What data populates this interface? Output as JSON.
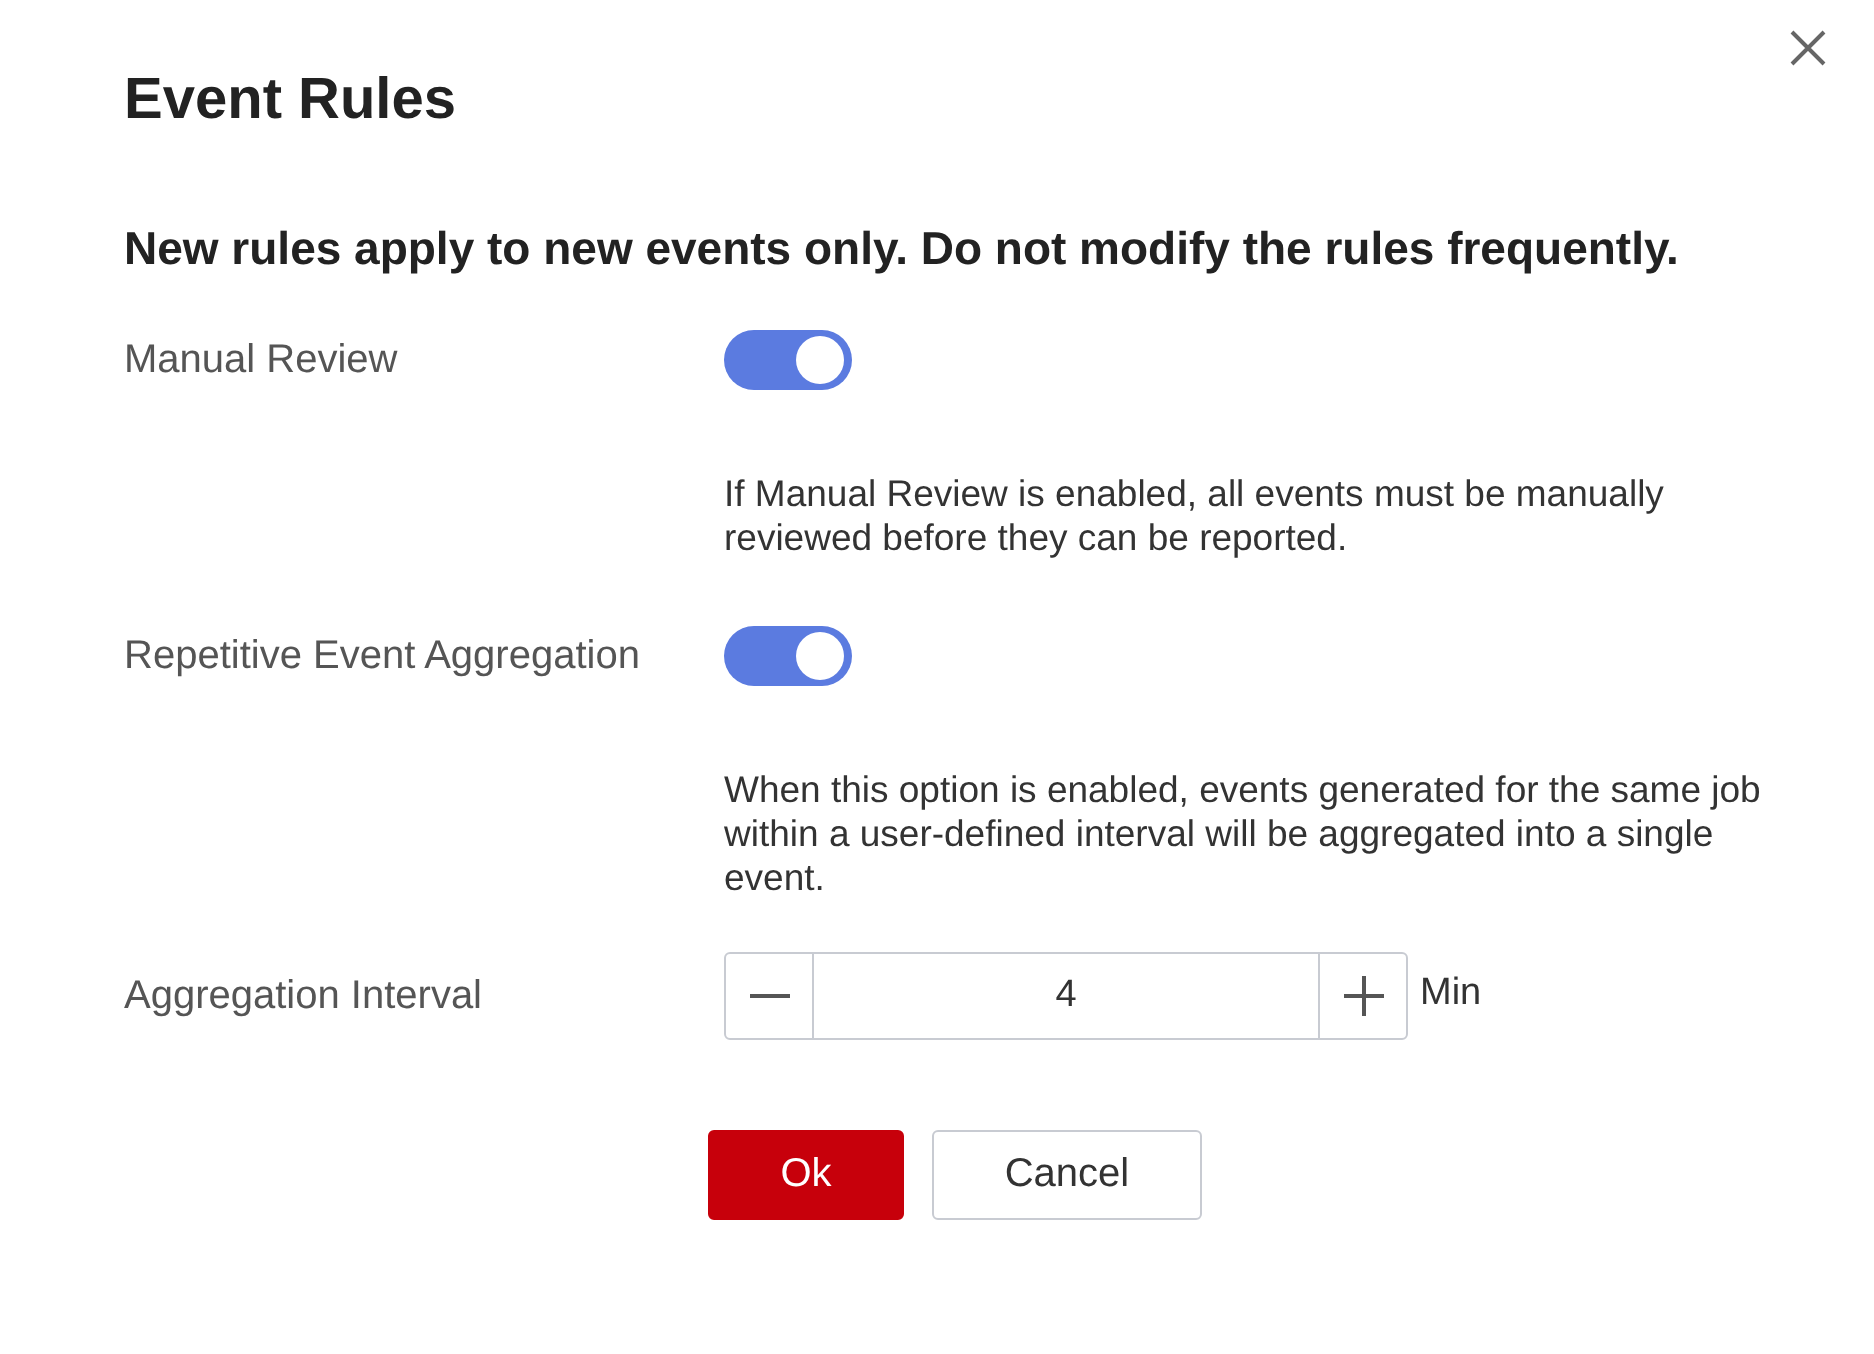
{
  "dialog": {
    "title": "Event Rules"
  },
  "notice": "New rules apply to new events only. Do not modify the rules frequently.",
  "settings": [
    {
      "kind": "toggle",
      "label": "Manual Review",
      "on": true,
      "help": "If Manual Review is enabled, all events must be manually reviewed before they can be reported."
    },
    {
      "kind": "toggle",
      "label": "Repetitive Event Aggregation",
      "on": true,
      "help": "When this option is enabled, events generated for the same job within a user-defined interval will be aggregated into a single event."
    },
    {
      "kind": "stepper",
      "label": "Aggregation Interval",
      "value": "4",
      "unit": "Min"
    }
  ],
  "buttons": [
    {
      "label": "Ok",
      "kind": "primary"
    },
    {
      "label": "Cancel",
      "kind": "secondary"
    }
  ]
}
